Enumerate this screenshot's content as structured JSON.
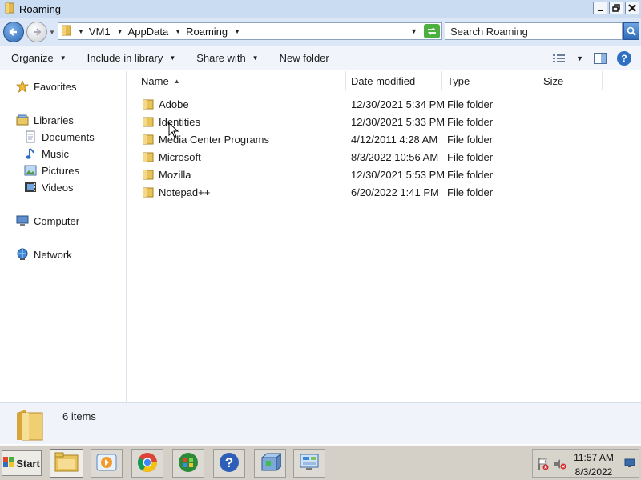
{
  "window": {
    "title": "Roaming",
    "buttons": [
      "minimize-button",
      "maximize-button",
      "close-button"
    ]
  },
  "address": {
    "crumbs": [
      "VM1",
      "AppData",
      "Roaming"
    ],
    "search_placeholder": "Search Roaming"
  },
  "toolbar": {
    "organize": "Organize",
    "include": "Include in library",
    "share": "Share with",
    "new_folder": "New folder"
  },
  "nav": {
    "favorites": "Favorites",
    "libraries": "Libraries",
    "documents": "Documents",
    "music": "Music",
    "pictures": "Pictures",
    "videos": "Videos",
    "computer": "Computer",
    "network": "Network"
  },
  "columns": {
    "name": "Name",
    "date": "Date modified",
    "type": "Type",
    "size": "Size"
  },
  "files": [
    {
      "name": "Adobe",
      "date": "12/30/2021 5:34 PM",
      "type": "File folder"
    },
    {
      "name": "Identities",
      "date": "12/30/2021 5:33 PM",
      "type": "File folder"
    },
    {
      "name": "Media Center Programs",
      "date": "4/12/2011 4:28 AM",
      "type": "File folder"
    },
    {
      "name": "Microsoft",
      "date": "8/3/2022 10:56 AM",
      "type": "File folder"
    },
    {
      "name": "Mozilla",
      "date": "12/30/2021 5:53 PM",
      "type": "File folder"
    },
    {
      "name": "Notepad++",
      "date": "6/20/2022 1:41 PM",
      "type": "File folder"
    }
  ],
  "details": {
    "count": "6 items"
  },
  "taskbar": {
    "start": "Start",
    "time": "11:57 AM",
    "date": "8/3/2022"
  },
  "icons": {
    "folder_color": "#e8c35a",
    "back_color": "#2d6ab8"
  }
}
